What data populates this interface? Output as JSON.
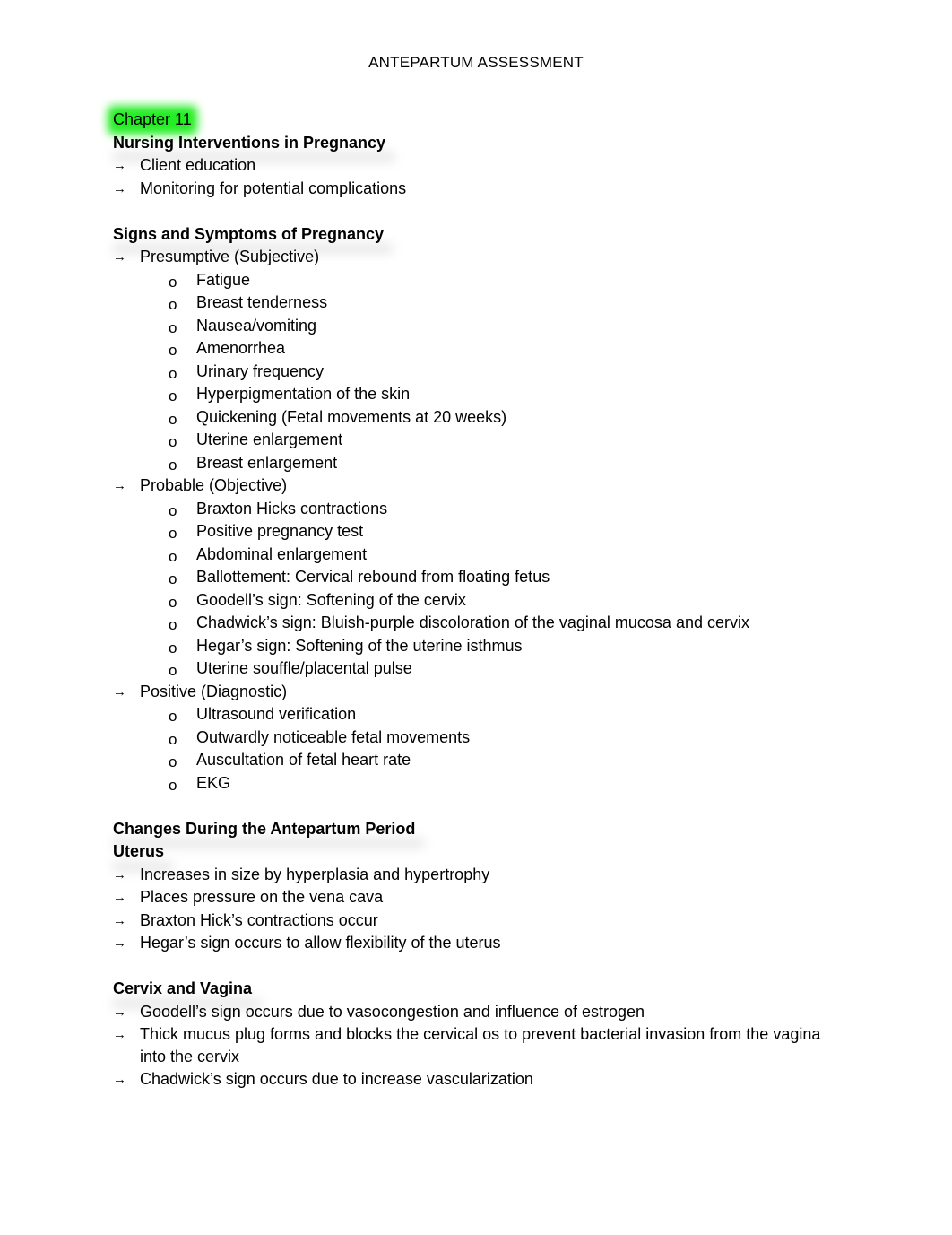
{
  "document": {
    "title": "ANTEPARTUM ASSESSMENT",
    "highlight_color": "#22ee22",
    "chapter": "Chapter 11",
    "sections": {
      "nursing": {
        "heading": "Nursing Interventions in Pregnancy",
        "items": [
          "Client education",
          "Monitoring for potential complications"
        ]
      },
      "signs": {
        "heading": "Signs and Symptoms of Pregnancy",
        "groups": [
          {
            "label": "Presumptive (Subjective)",
            "items": [
              "Fatigue",
              "Breast tenderness",
              "Nausea/vomiting",
              "Amenorrhea",
              "Urinary frequency",
              "Hyperpigmentation of the skin",
              "Quickening (Fetal movements at 20 weeks)",
              "Uterine enlargement",
              "Breast enlargement"
            ]
          },
          {
            "label": "Probable (Objective)",
            "items": [
              "Braxton Hicks contractions",
              "Positive pregnancy test",
              "Abdominal enlargement",
              "Ballottement: Cervical rebound from floating fetus",
              "Goodell’s sign: Softening of the cervix",
              "Chadwick’s sign: Bluish-purple discoloration of the vaginal mucosa and cervix",
              "Hegar’s sign: Softening of the uterine isthmus",
              "Uterine souffle/placental pulse"
            ]
          },
          {
            "label": "Positive (Diagnostic)",
            "items": [
              "Ultrasound verification",
              "Outwardly noticeable fetal movements",
              "Auscultation of fetal heart rate",
              "EKG"
            ]
          }
        ]
      },
      "changes": {
        "heading": "Changes During the Antepartum Period",
        "uterus": {
          "heading": "Uterus",
          "items": [
            "Increases in size by hyperplasia and hypertrophy",
            "Places pressure on the vena cava",
            "Braxton Hick’s contractions occur",
            "Hegar’s sign occurs to allow flexibility of the uterus"
          ]
        },
        "cervix": {
          "heading": "Cervix and Vagina",
          "items": [
            "Goodell’s sign occurs due to vasocongestion and influence of estrogen",
            "Thick mucus plug forms and blocks the cervical os to prevent bacterial invasion from the vagina into the cervix",
            "Chadwick’s sign occurs due to increase vascularization"
          ]
        }
      }
    },
    "glyphs": {
      "arrow": "→",
      "bullet": "o"
    }
  }
}
